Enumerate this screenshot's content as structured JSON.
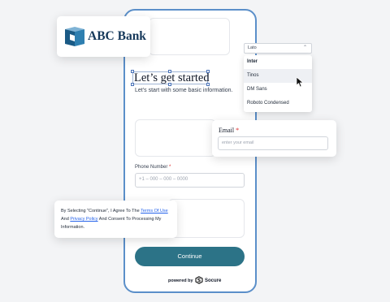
{
  "bank": {
    "name": "ABC Bank"
  },
  "heading": {
    "title": "Let’s get started",
    "subtitle": "Let’s start with some basic information."
  },
  "font_select": {
    "value": "Lato",
    "options": [
      "Inter",
      "Tinos",
      "DM Sans",
      "Roboto Condensed"
    ],
    "hovered": "Tinos"
  },
  "email": {
    "label": "Email",
    "required_mark": "*",
    "placeholder": "enter your email"
  },
  "phone": {
    "label": "Phone Number",
    "required_mark": "*",
    "placeholder": "+1 – 000 – 000 – 0000"
  },
  "consent": {
    "prefix": "By Selecting \"Continue\", I Agree To The",
    "terms_link": "Terms Of Use",
    "and": "And",
    "privacy_link": "Privacy Policy",
    "suffix": "And Consent To Processing My Information."
  },
  "continue_label": "Continue",
  "footer": {
    "powered_by": "powered by",
    "brand": "Socure"
  },
  "colors": {
    "primary": "#2c7387",
    "frame": "#5b8fc9",
    "required": "#dc2626",
    "link": "#2563eb",
    "bank_navy": "#15385a"
  }
}
